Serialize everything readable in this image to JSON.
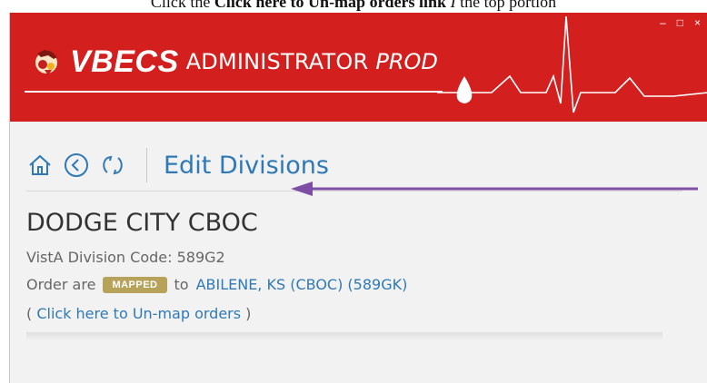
{
  "doc_caption": {
    "prefix": "Click the ",
    "bold_text": "Click here to Un-map orders link",
    "suffix_italic": "I ",
    "tail": "the top portion"
  },
  "window": {
    "brand": "VBECS",
    "title_rest": "ADMINISTRATOR",
    "env": "PROD",
    "controls": {
      "minimize": "–",
      "maximize": "□",
      "close": "×"
    },
    "colors": {
      "header": "#d3201f",
      "accent_blue": "#2e79b6",
      "badge": "#b7a25a",
      "arrow": "#7d4ea3"
    }
  },
  "nav": {
    "icons": [
      "home-icon",
      "back-icon",
      "refresh-icon"
    ],
    "title": "Edit Divisions"
  },
  "division": {
    "name": "DODGE CITY CBOC",
    "code_label": "VistA Division Code: ",
    "code_value": "589G2",
    "order_prefix": "Order are",
    "status_badge": "MAPPED",
    "to_text": "to",
    "mapped_to": "ABILENE, KS (CBOC) (589GK)",
    "unmap_open": "( ",
    "unmap_link": "Click here to Un-map orders",
    "unmap_close": " )"
  }
}
